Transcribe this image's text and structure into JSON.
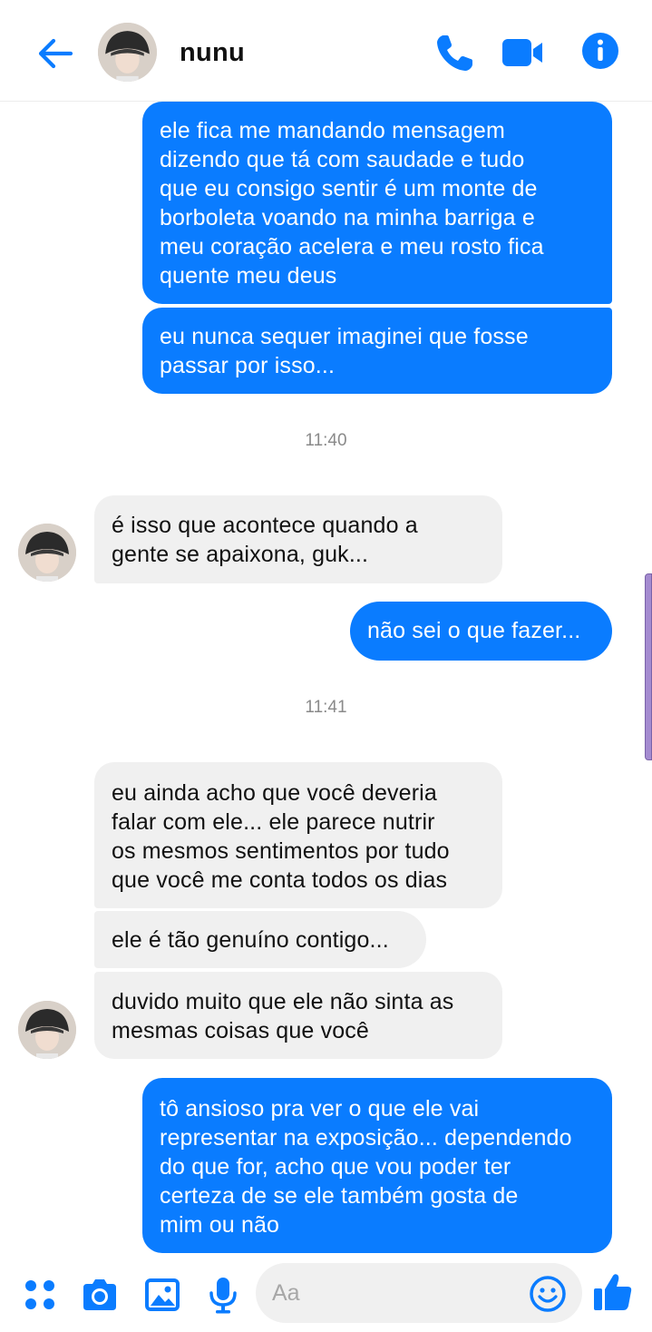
{
  "header": {
    "contact_name": "nunu",
    "back_icon": "arrow-left-icon",
    "call_icon": "phone-icon",
    "video_icon": "video-camera-icon",
    "info_icon": "info-icon"
  },
  "colors": {
    "accent": "#0a7cff",
    "incoming_bubble": "#f0f0f0",
    "timestamp": "#8a8a8a"
  },
  "messages": [
    {
      "direction": "outgoing",
      "text": "ele fica me mandando mensagem\ndizendo que tá com saudade e tudo\nque eu consigo sentir é um monte de\nborboleta voando na minha barriga e\nmeu coração acelera e meu rosto fica\nquente meu deus"
    },
    {
      "direction": "outgoing",
      "text": "eu nunca sequer imaginei que fosse\npassar por isso..."
    },
    {
      "type": "timestamp",
      "text": "11:40"
    },
    {
      "direction": "incoming",
      "text": "é isso que acontece quando a\ngente se apaixona, guk..."
    },
    {
      "direction": "outgoing",
      "text": "não sei o que fazer..."
    },
    {
      "type": "timestamp",
      "text": "11:41"
    },
    {
      "direction": "incoming",
      "text": "eu ainda acho que você deveria\nfalar com ele... ele parece nutrir\nos mesmos sentimentos por tudo\nque você me conta todos os dias"
    },
    {
      "direction": "incoming",
      "text": "ele é tão genuíno contigo..."
    },
    {
      "direction": "incoming",
      "text": "duvido muito que ele não sinta as\nmesmas coisas que você"
    },
    {
      "direction": "outgoing",
      "text": "tô ansioso pra ver o que ele vai\nrepresentar na exposição... dependendo\ndo que for, acho que vou poder ter\ncerteza de se ele também gosta de\nmim ou não"
    }
  ],
  "composer": {
    "placeholder": "Aa",
    "icons": [
      "apps-icon",
      "camera-icon",
      "gallery-icon",
      "microphone-icon",
      "emoji-icon",
      "thumbs-up-icon"
    ]
  }
}
